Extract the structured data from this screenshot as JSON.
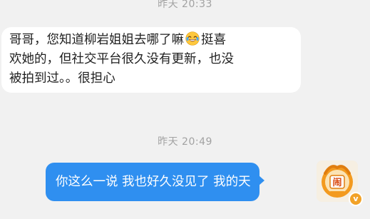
{
  "timestamps": {
    "top": "昨天 20:33",
    "middle": "昨天 20:49"
  },
  "incoming_message": {
    "line1_before_emoji": "哥哥，您知道柳岩姐姐去哪了嘛",
    "emoji": "laughing-with-tears-emoji",
    "line1_after_emoji": "挺喜",
    "line2": "欢她的，但社交平台很久没有更新，也没",
    "line3": "被拍到过。。很担心"
  },
  "outgoing_message": {
    "text": "你这么一说 我也好久没见了 我的天"
  },
  "avatar": {
    "icon": "cartoon-avatar-icon",
    "badge": "verified-badge-icon",
    "badge_symbol": "v"
  },
  "colors": {
    "background": "#f1f1f1",
    "incoming_bubble": "#ffffff",
    "outgoing_bubble": "#2f8ff0",
    "timestamp_text": "#a2a2a2",
    "badge": "#f2a227"
  }
}
